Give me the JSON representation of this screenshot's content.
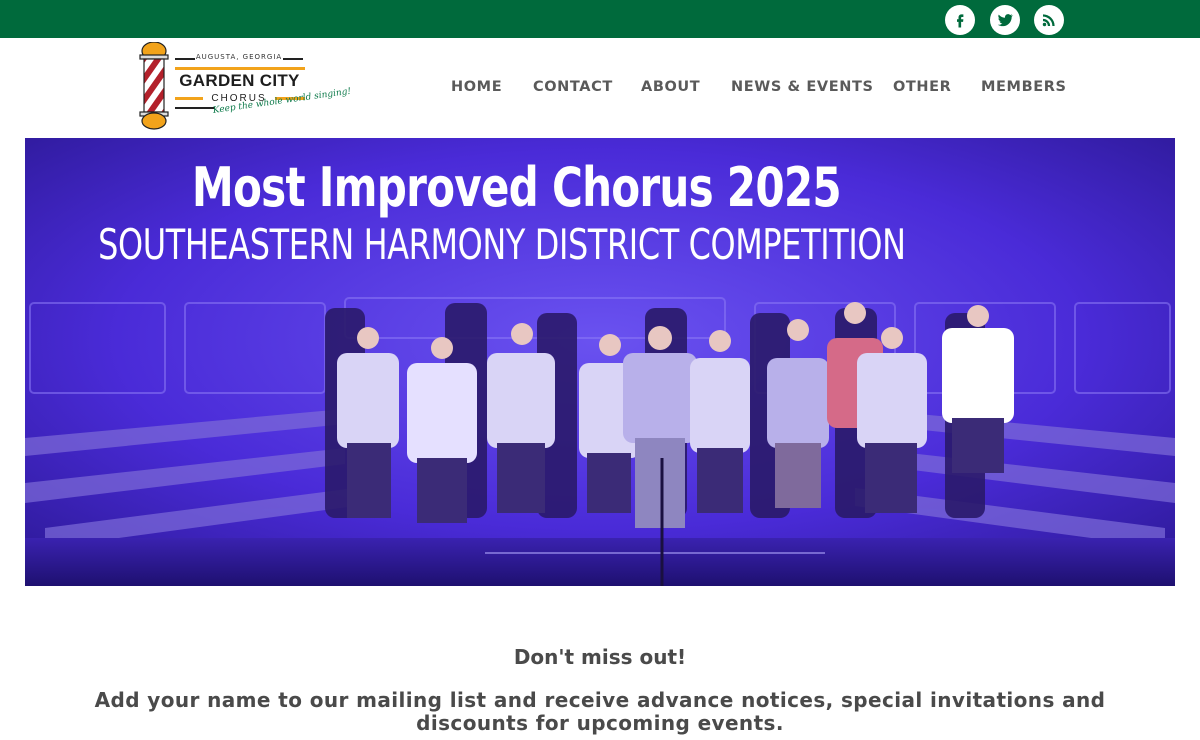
{
  "topbar": {
    "color": "#006a3c",
    "social": [
      {
        "icon": "facebook-icon",
        "label": "f"
      },
      {
        "icon": "twitter-icon"
      },
      {
        "icon": "rss-icon"
      }
    ]
  },
  "logo": {
    "small": "AUGUSTA, GEORGIA",
    "title": "GARDEN CITY",
    "sub": "CHORUS",
    "tagline": "Keep the whole world singing!"
  },
  "nav": {
    "items": [
      "HOME",
      "CONTACT",
      "ABOUT",
      "NEWS & EVENTS",
      "OTHER",
      "MEMBERS"
    ]
  },
  "hero": {
    "title": "Most Improved Chorus 2025",
    "subtitle": "SOUTHEASTERN HARMONY DISTRICT COMPETITION",
    "background": "#4a2bd8"
  },
  "cta": {
    "heading": "Don't miss out!",
    "text": "Add your name to our mailing list and receive advance notices, special invitations and discounts for upcoming events."
  }
}
